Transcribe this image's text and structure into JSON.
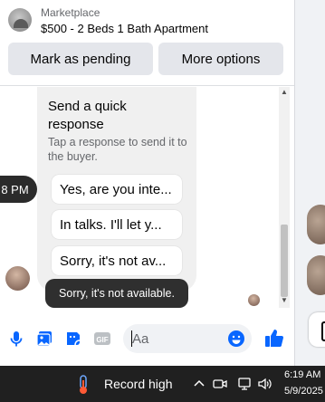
{
  "header": {
    "kicker": "Marketplace",
    "listing_title": "$500 - 2 Beds 1 Bath Apartment",
    "mark_pending_label": "Mark as pending",
    "more_options_label": "More options"
  },
  "quick_response": {
    "title": "Send a quick response",
    "subtitle": "Tap a response to send it to the buyer.",
    "options": [
      "Yes, are you inte...",
      "In talks. I'll let y...",
      "Sorry, it's not av..."
    ]
  },
  "thread": {
    "time_label": "8 PM",
    "tooltip": "Sorry, it's not available."
  },
  "composer": {
    "placeholder": "Aa",
    "icons": [
      "microphone-icon",
      "photo-icon",
      "sticker-icon",
      "gif-icon",
      "emoji-icon",
      "thumbs-up-icon"
    ]
  },
  "taskbar": {
    "weather_label": "Record high",
    "time": "6:19 AM",
    "date": "5/9/2025"
  },
  "colors": {
    "accent": "#0866ff",
    "chip_bg": "#f0f0f0",
    "button_bg": "#e4e6eb",
    "taskbar_bg": "#202020"
  }
}
